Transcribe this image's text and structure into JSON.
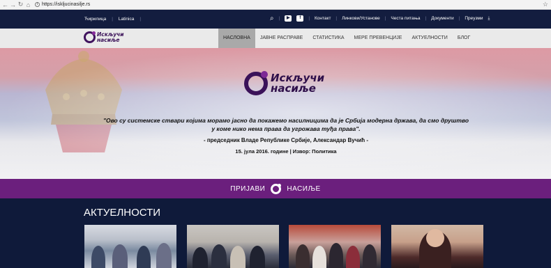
{
  "browser": {
    "url": "https://iskljucinasilje.rs",
    "secure_icon": "info-icon"
  },
  "topbar": {
    "lang_cyr": "Ћирилица",
    "lang_lat": "Latinica",
    "contact": "Контакт",
    "persons": "Линкови/Установе",
    "faq": "Честа питања",
    "documents": "Документи",
    "downloads": "Преузми"
  },
  "logo": {
    "line1": "Искључи",
    "line2": "насиље"
  },
  "menu": [
    {
      "label": "НАСЛОВНА",
      "active": true
    },
    {
      "label": "ЈАВНЕ РАСПРАВЕ",
      "active": false
    },
    {
      "label": "СТАТИСТИКА",
      "active": false
    },
    {
      "label": "МЕРЕ ПРЕВЕНЦИЈЕ",
      "active": false
    },
    {
      "label": "АКТУЕЛНОСТИ",
      "active": false
    },
    {
      "label": "БЛОГ",
      "active": false
    }
  ],
  "hero": {
    "quote": "\"Ово су системске ствари којима морамо јасно да покажемо насилницима да је Србија модерна држава, да смо друштво у коме нико нема права да угрожава туђа права\".",
    "author": "- председник Владе Републике Србије, Александар Вучић -",
    "date": "15. јула 2016. године | Извор: Политика"
  },
  "report": {
    "left": "ПРИЈАВИ",
    "right": "НАСИЉЕ"
  },
  "news": {
    "title": "АКТУЕЛНОСТИ"
  },
  "colors": {
    "navy": "#131d3f",
    "purple": "#6b1f7d",
    "logo": "#3b1259"
  }
}
